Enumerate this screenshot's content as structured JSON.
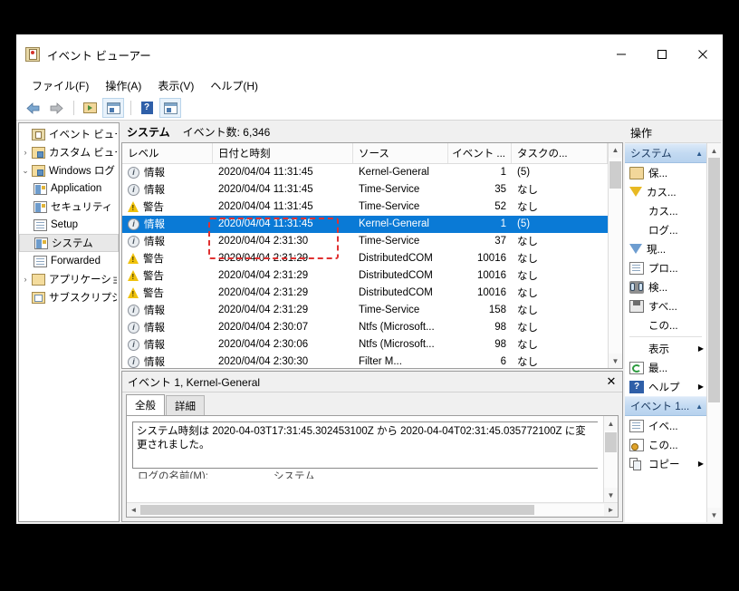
{
  "window": {
    "title": "イベント ビューアー",
    "minimize_label": "最小化",
    "maximize_label": "最大化",
    "close_label": "閉じる"
  },
  "menubar": [
    {
      "label": "ファイル(F)"
    },
    {
      "label": "操作(A)"
    },
    {
      "label": "表示(V)"
    },
    {
      "label": "ヘルプ(H)"
    }
  ],
  "toolbar": [
    {
      "name": "back",
      "icon": "back-arrow-icon"
    },
    {
      "name": "forward",
      "icon": "forward-arrow-icon"
    },
    {
      "name": "open-saved-log",
      "icon": "folder-icon"
    },
    {
      "name": "show-pane",
      "icon": "window-icon"
    },
    {
      "name": "help",
      "icon": "help-icon"
    },
    {
      "name": "show-action-pane",
      "icon": "window-icon"
    }
  ],
  "sidebar": {
    "root_label": "イベント ビューアー",
    "items": [
      {
        "label": "カスタム ビュー",
        "icon": "folder-view-icon",
        "twisty": "›",
        "indent": 1,
        "selected": false
      },
      {
        "label": "Windows ログ",
        "icon": "folder-log-icon",
        "twisty": "⌄",
        "indent": 1,
        "selected": false
      },
      {
        "label": "Application",
        "icon": "log-key-icon",
        "twisty": "",
        "indent": 2,
        "selected": false
      },
      {
        "label": "セキュリティ",
        "icon": "log-key-icon",
        "twisty": "",
        "indent": 2,
        "selected": false
      },
      {
        "label": "Setup",
        "icon": "log-icon",
        "twisty": "",
        "indent": 2,
        "selected": false
      },
      {
        "label": "システム",
        "icon": "log-key-icon",
        "twisty": "",
        "indent": 2,
        "selected": true
      },
      {
        "label": "Forwarded",
        "icon": "log-icon",
        "twisty": "",
        "indent": 2,
        "selected": false
      },
      {
        "label": "アプリケーション",
        "icon": "folder-icon",
        "twisty": "›",
        "indent": 1,
        "selected": false
      },
      {
        "label": "サブスクリプション",
        "icon": "subscription-icon",
        "twisty": "",
        "indent": 1,
        "selected": false
      }
    ]
  },
  "list": {
    "header_name": "システム",
    "header_count": "イベント数: 6,346",
    "columns": [
      {
        "label": "レベル",
        "key": "level"
      },
      {
        "label": "日付と時刻",
        "key": "datetime"
      },
      {
        "label": "ソース",
        "key": "source"
      },
      {
        "label": "イベント ...",
        "key": "event_id"
      },
      {
        "label": "タスクの...",
        "key": "task"
      }
    ],
    "rows": [
      {
        "level": "情報",
        "level_icon": "info-icon",
        "datetime": "2020/04/04 11:31:45",
        "source": "Kernel-General",
        "event_id": "1",
        "task": "(5)",
        "selected": false
      },
      {
        "level": "情報",
        "level_icon": "info-icon",
        "datetime": "2020/04/04 11:31:45",
        "source": "Time-Service",
        "event_id": "35",
        "task": "なし",
        "selected": false
      },
      {
        "level": "警告",
        "level_icon": "warning-icon",
        "datetime": "2020/04/04 11:31:45",
        "source": "Time-Service",
        "event_id": "52",
        "task": "なし",
        "selected": false
      },
      {
        "level": "情報",
        "level_icon": "info-icon",
        "datetime": "2020/04/04 11:31:45",
        "source": "Kernel-General",
        "event_id": "1",
        "task": "(5)",
        "selected": true
      },
      {
        "level": "情報",
        "level_icon": "info-icon",
        "datetime": "2020/04/04 2:31:30",
        "source": "Time-Service",
        "event_id": "37",
        "task": "なし",
        "selected": false
      },
      {
        "level": "警告",
        "level_icon": "warning-icon",
        "datetime": "2020/04/04 2:31:29",
        "source": "DistributedCOM",
        "event_id": "10016",
        "task": "なし",
        "selected": false
      },
      {
        "level": "警告",
        "level_icon": "warning-icon",
        "datetime": "2020/04/04 2:31:29",
        "source": "DistributedCOM",
        "event_id": "10016",
        "task": "なし",
        "selected": false
      },
      {
        "level": "警告",
        "level_icon": "warning-icon",
        "datetime": "2020/04/04 2:31:29",
        "source": "DistributedCOM",
        "event_id": "10016",
        "task": "なし",
        "selected": false
      },
      {
        "level": "情報",
        "level_icon": "info-icon",
        "datetime": "2020/04/04 2:31:29",
        "source": "Time-Service",
        "event_id": "158",
        "task": "なし",
        "selected": false
      },
      {
        "level": "情報",
        "level_icon": "info-icon",
        "datetime": "2020/04/04 2:30:07",
        "source": "Ntfs (Microsoft...",
        "event_id": "98",
        "task": "なし",
        "selected": false
      },
      {
        "level": "情報",
        "level_icon": "info-icon",
        "datetime": "2020/04/04 2:30:06",
        "source": "Ntfs (Microsoft...",
        "event_id": "98",
        "task": "なし",
        "selected": false
      },
      {
        "level": "情報",
        "level_icon": "info-icon",
        "datetime": "2020/04/04 2:30:30",
        "source": "Filter M...",
        "event_id": "6",
        "task": "なし",
        "selected": false
      }
    ]
  },
  "detail": {
    "title": "イベント 1, Kernel-General",
    "close_label": "✕",
    "tabs": [
      {
        "label": "全般",
        "active": true
      },
      {
        "label": "詳細",
        "active": false
      }
    ],
    "message": "システム時刻は 2020-04-03T17:31:45.302453100Z から 2020-04-04T02:31:45.035772100Z に変更されました。",
    "clipped_field_label": "ログの名前(M):",
    "clipped_field_value": "システム"
  },
  "actions": {
    "header": "操作",
    "groups": [
      {
        "name": "システム",
        "caret": "▲",
        "items": [
          {
            "label": "保...",
            "icon": "open-folder-icon",
            "submenu": false
          },
          {
            "label": "カス...",
            "icon": "filter-yellow-icon",
            "submenu": false
          },
          {
            "label": "カス...",
            "icon": "none",
            "submenu": false
          },
          {
            "label": "ログ...",
            "icon": "none",
            "submenu": false
          },
          {
            "label": "現...",
            "icon": "filter-blue-icon",
            "submenu": false
          },
          {
            "label": "プロ...",
            "icon": "properties-icon",
            "submenu": false
          },
          {
            "label": "検...",
            "icon": "find-icon",
            "submenu": false
          },
          {
            "label": "すべ...",
            "icon": "save-icon",
            "submenu": false
          },
          {
            "label": "この...",
            "icon": "none",
            "submenu": false
          },
          {
            "label": "表示",
            "icon": "none",
            "submenu": true
          },
          {
            "label": "最...",
            "icon": "refresh-icon",
            "submenu": false
          },
          {
            "label": "ヘルプ",
            "icon": "help-icon",
            "submenu": true
          }
        ]
      },
      {
        "name": "イベント 1...",
        "caret": "▲",
        "items": [
          {
            "label": "イベ...",
            "icon": "event-properties-icon",
            "submenu": false
          },
          {
            "label": "この...",
            "icon": "attach-task-icon",
            "submenu": false
          },
          {
            "label": "コピー",
            "icon": "copy-icon",
            "submenu": true
          }
        ]
      }
    ]
  },
  "annotation": {
    "color": "#e03131",
    "shape": "dashed-rectangle"
  },
  "colors": {
    "selection_blue": "#0a7ad6",
    "group_header_blue": "#c3daf2",
    "annotation_red": "#e03131"
  }
}
